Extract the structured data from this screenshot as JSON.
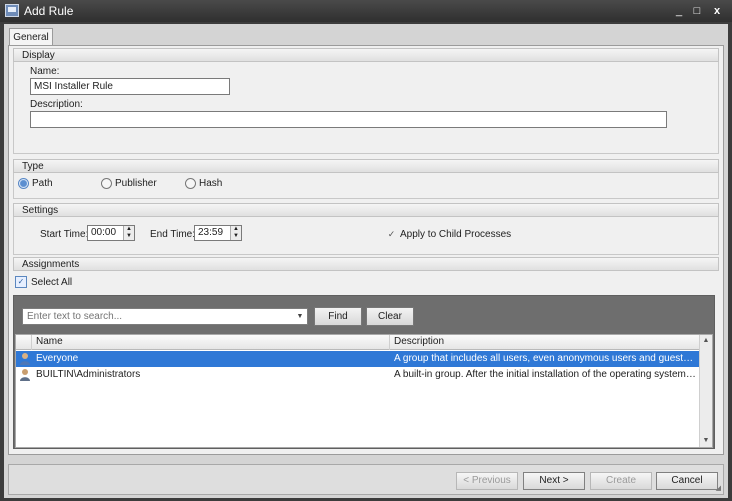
{
  "window": {
    "title": "Add Rule",
    "min": "_",
    "max": "□",
    "close": "x"
  },
  "tabs": [
    {
      "label": "General"
    }
  ],
  "display": {
    "header": "Display",
    "name_label": "Name:",
    "name_value": "MSI Installer Rule",
    "description_label": "Description:",
    "description_value": ""
  },
  "type": {
    "header": "Type",
    "options": [
      {
        "label": "Path",
        "selected": true
      },
      {
        "label": "Publisher",
        "selected": false
      },
      {
        "label": "Hash",
        "selected": false
      }
    ]
  },
  "settings": {
    "header": "Settings",
    "start_label": "Start Time:",
    "start_value": "00:00",
    "end_label": "End Time:",
    "end_value": "23:59",
    "apply_label": "Apply to Child Processes",
    "apply_checked": true
  },
  "assignments": {
    "header": "Assignments",
    "select_all": "Select All",
    "search_placeholder": "Enter text to search...",
    "find": "Find",
    "clear": "Clear",
    "columns": [
      "Name",
      "Description"
    ],
    "rows": [
      {
        "name": "Everyone",
        "description": "A group that includes all users, even anonymous users and guests. Memb...",
        "selected": true
      },
      {
        "name": "BUILTIN\\Administrators",
        "description": "A built-in group. After the initial installation of the operating system, the o...",
        "selected": false
      }
    ]
  },
  "footer": {
    "previous": "< Previous",
    "next": "Next >",
    "create": "Create",
    "cancel": "Cancel"
  },
  "colors": {
    "selection": "#2F78D6",
    "title_bar": "#3C3C3C",
    "panel": "#F0F0F0"
  }
}
